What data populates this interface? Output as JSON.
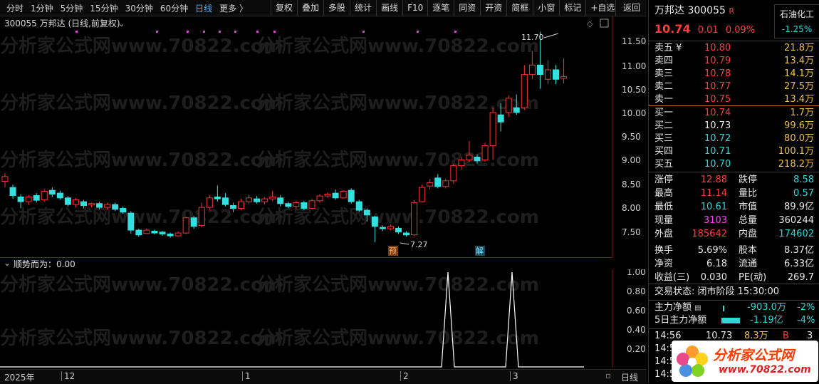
{
  "toolbar": {
    "periods": [
      "分时",
      "1分钟",
      "5分钟",
      "15分钟",
      "30分钟",
      "60分钟",
      "日线",
      "更多 〉"
    ],
    "active_period_index": 6,
    "buttons": [
      "复权",
      "叠加",
      "多股",
      "统计",
      "画线",
      "F10",
      "逐笔",
      "同资",
      "开资",
      "简框",
      "小窗",
      "标记",
      "+自选"
    ],
    "back": "返回"
  },
  "chart": {
    "title": "300055 万邦达 (日线,前复权)",
    "price_axis": [
      "11.50",
      "11.00",
      "10.50",
      "10.00",
      "9.50",
      "9.00",
      "8.50",
      "8.00",
      "7.50"
    ],
    "high_label": "11.70",
    "low_label": "7.27",
    "marker_yu": "预",
    "marker_jie": "解",
    "watermark": "分析家公式网www.70822.com"
  },
  "indicator": {
    "label": "顺势而为：0.00",
    "axis": [
      "1.00",
      "0.80",
      "0.60",
      "0.40",
      "0.20"
    ]
  },
  "time_axis": {
    "labels": [
      "2025年",
      "12",
      "1",
      "2",
      "3"
    ],
    "period": "日线"
  },
  "stock": {
    "name": "万邦达",
    "code": "300055",
    "r_badge": "R",
    "sector": "石油化工",
    "sector_change": "-1.25%",
    "price": "10.74",
    "change": "0.01",
    "change_pct": "0.09%"
  },
  "order_book": {
    "asks": [
      {
        "label": "卖五 ¥",
        "price": "10.80",
        "vol": "21.8万"
      },
      {
        "label": "卖四",
        "price": "10.79",
        "vol": "13.4万"
      },
      {
        "label": "卖三",
        "price": "10.78",
        "vol": "14.1万"
      },
      {
        "label": "卖二",
        "price": "10.77",
        "vol": "27.5万"
      },
      {
        "label": "卖一",
        "price": "10.75",
        "vol": "13.4万"
      }
    ],
    "bids": [
      {
        "label": "买一",
        "price": "10.74",
        "vol": "1.7万"
      },
      {
        "label": "买二",
        "price": "10.73",
        "vol": "99.6万"
      },
      {
        "label": "买三",
        "price": "10.72",
        "vol": "80.0万"
      },
      {
        "label": "买四",
        "price": "10.71",
        "vol": "100.1万"
      },
      {
        "label": "买五",
        "price": "10.70",
        "vol": "218.2万"
      }
    ]
  },
  "quote": {
    "limit_up_label": "涨停",
    "limit_up": "12.88",
    "limit_down_label": "跌停",
    "limit_down": "8.58",
    "high_label": "最高",
    "high": "11.14",
    "vol_ratio_label": "量比",
    "vol_ratio": "0.57",
    "low_label": "最低",
    "low": "10.61",
    "mktcap_label": "市值",
    "mktcap": "89.9亿",
    "cur_vol_label": "现量",
    "cur_vol": "3103",
    "total_vol_label": "总量",
    "total_vol": "360244",
    "outer_label": "外盘",
    "outer": "185642",
    "inner_label": "内盘",
    "inner": "174602",
    "turnover_label": "换手",
    "turnover": "5.69%",
    "share_label": "股本",
    "share": "8.37亿",
    "nav_label": "净资",
    "nav": "6.18",
    "float_label": "流通",
    "float": "6.33亿",
    "eps_label": "收益(三)",
    "eps": "0.030",
    "pe_label": "PE(动)",
    "pe": "269.7"
  },
  "trade_status": "交易状态: 闭市阶段 15:30:00",
  "flows": [
    {
      "label": "主力净额",
      "value": "-903.0万",
      "pct": "-2%"
    },
    {
      "label": "5日主力净额",
      "value": "-1.19亿",
      "pct": "-4%"
    }
  ],
  "tick": {
    "time": "14:56",
    "price": "10.73",
    "vol": "8.3万",
    "side": "B",
    "count": "3"
  },
  "tick_times": [
    "14:5",
    "14:5",
    "14:5"
  ],
  "logo": {
    "title": "分析家公式网",
    "url": "www.70822.com"
  }
}
